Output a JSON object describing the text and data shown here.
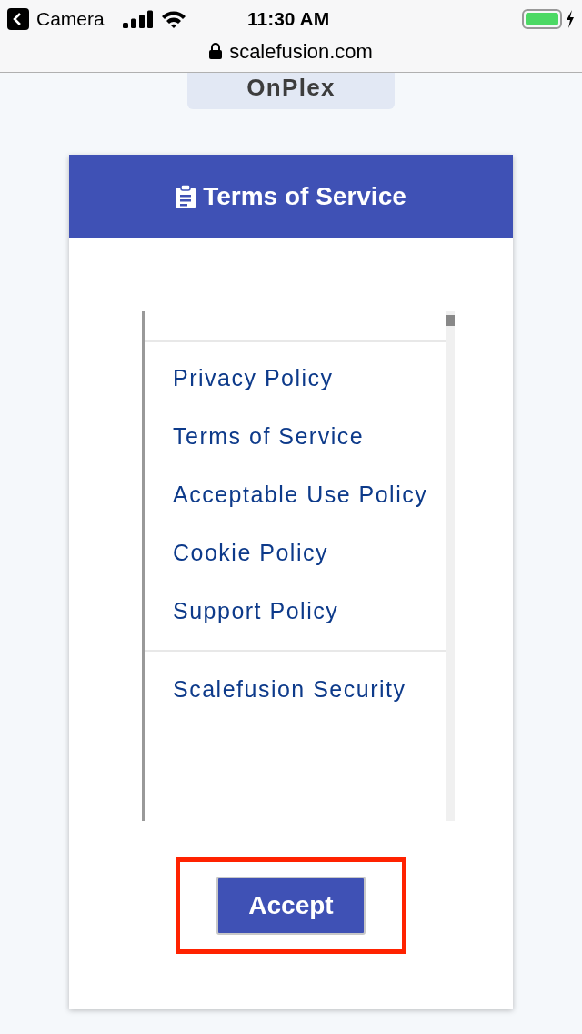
{
  "status_bar": {
    "back_label": "Camera",
    "time": "11:30 AM",
    "charging": true
  },
  "address_bar": {
    "url": "scalefusion.com",
    "secure": true
  },
  "brand": {
    "name": "OnPlex"
  },
  "dialog": {
    "title": "Terms of Service",
    "link_groups": [
      [
        "Privacy Policy",
        "Terms of Service",
        "Acceptable Use Policy",
        "Cookie Policy",
        "Support Policy"
      ],
      [
        "Scalefusion Security"
      ]
    ],
    "accept_button": {
      "label": "Accept",
      "highlighted": true
    }
  }
}
